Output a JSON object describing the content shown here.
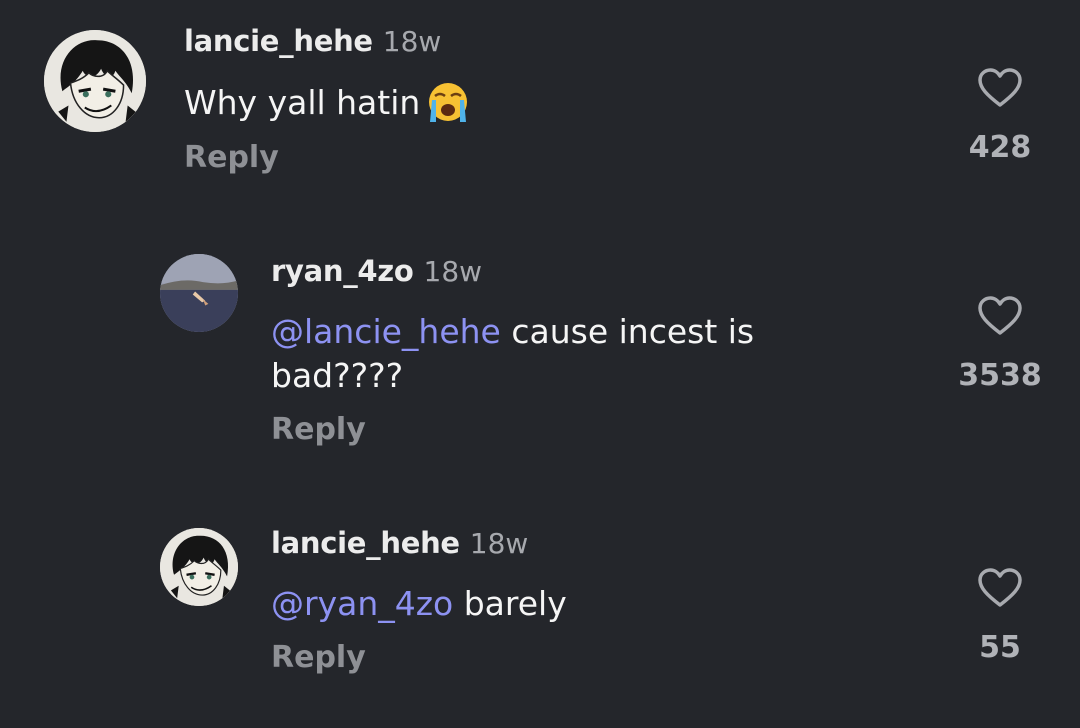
{
  "comments": [
    {
      "username": "lancie_hehe",
      "time": "18w",
      "text": "Why yall hatin",
      "emoji": "loudly-crying-face",
      "reply_label": "Reply",
      "likes": "428"
    },
    {
      "username": "ryan_4zo",
      "time": "18w",
      "mention": "@lancie_hehe",
      "text_line1": " cause incest is",
      "text_line2": "bad????",
      "reply_label": "Reply",
      "likes": "3538"
    },
    {
      "username": "lancie_hehe",
      "time": "18w",
      "mention": "@ryan_4zo",
      "text": " barely",
      "reply_label": "Reply",
      "likes": "55"
    }
  ],
  "colors": {
    "background": "#24262b",
    "mention": "#8d92f2",
    "secondary_text": "#8e9095"
  },
  "icons": [
    "heart-outline-icon"
  ]
}
